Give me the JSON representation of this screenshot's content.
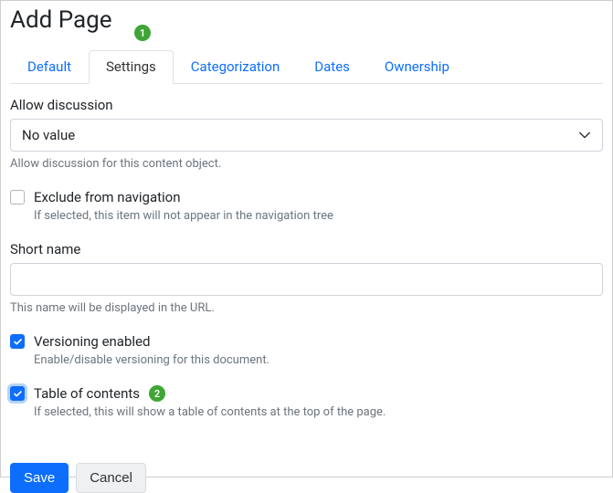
{
  "title": "Add Page",
  "badges": {
    "title": "1",
    "toc": "2"
  },
  "tabs": [
    {
      "label": "Default",
      "active": false
    },
    {
      "label": "Settings",
      "active": true
    },
    {
      "label": "Categorization",
      "active": false
    },
    {
      "label": "Dates",
      "active": false
    },
    {
      "label": "Ownership",
      "active": false
    }
  ],
  "allow_discussion": {
    "label": "Allow discussion",
    "value": "No value",
    "help": "Allow discussion for this content object."
  },
  "exclude_nav": {
    "label": "Exclude from navigation",
    "checked": false,
    "help": "If selected, this item will not appear in the navigation tree"
  },
  "short_name": {
    "label": "Short name",
    "value": "",
    "help": "This name will be displayed in the URL."
  },
  "versioning": {
    "label": "Versioning enabled",
    "checked": true,
    "help": "Enable/disable versioning for this document."
  },
  "toc": {
    "label": "Table of contents",
    "checked": true,
    "help": "If selected, this will show a table of contents at the top of the page."
  },
  "buttons": {
    "save": "Save",
    "cancel": "Cancel"
  }
}
